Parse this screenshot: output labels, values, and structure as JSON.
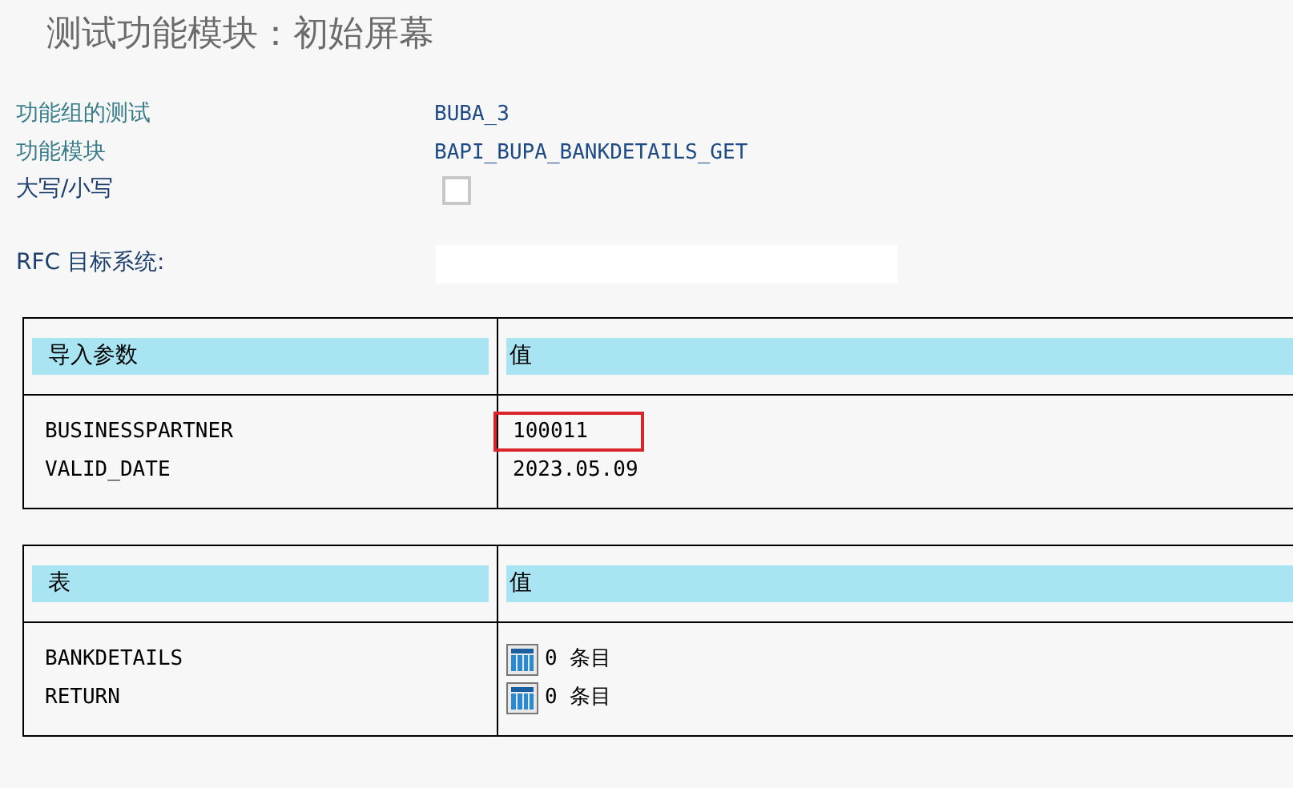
{
  "title": "测试功能模块：初始屏幕",
  "fields": [
    {
      "label": "功能组的测试",
      "value": "BUBA_3",
      "kind": "text",
      "color": "#3a7d8a"
    },
    {
      "label": "功能模块",
      "value": "BAPI_BUPA_BANKDETAILS_GET",
      "kind": "text",
      "color": "#3a7d8a"
    },
    {
      "label": "大写/小写",
      "kind": "checkbox",
      "checked": false,
      "color": "#1c3f6e"
    }
  ],
  "rfc": {
    "label": "RFC 目标系统:"
  },
  "tables": [
    {
      "header": [
        "导入参数",
        "值"
      ],
      "rows": [
        {
          "name": "BUSINESSPARTNER",
          "value": "100011",
          "kind": "text",
          "highlighted": true
        },
        {
          "name": "VALID_DATE",
          "value": "2023.05.09",
          "kind": "text",
          "highlighted": false
        }
      ]
    },
    {
      "header": [
        "表",
        "值"
      ],
      "rows": [
        {
          "name": "BANKDETAILS",
          "value": "0 条目",
          "kind": "table"
        },
        {
          "name": "RETURN",
          "value": "0 条目",
          "kind": "table"
        }
      ]
    }
  ]
}
